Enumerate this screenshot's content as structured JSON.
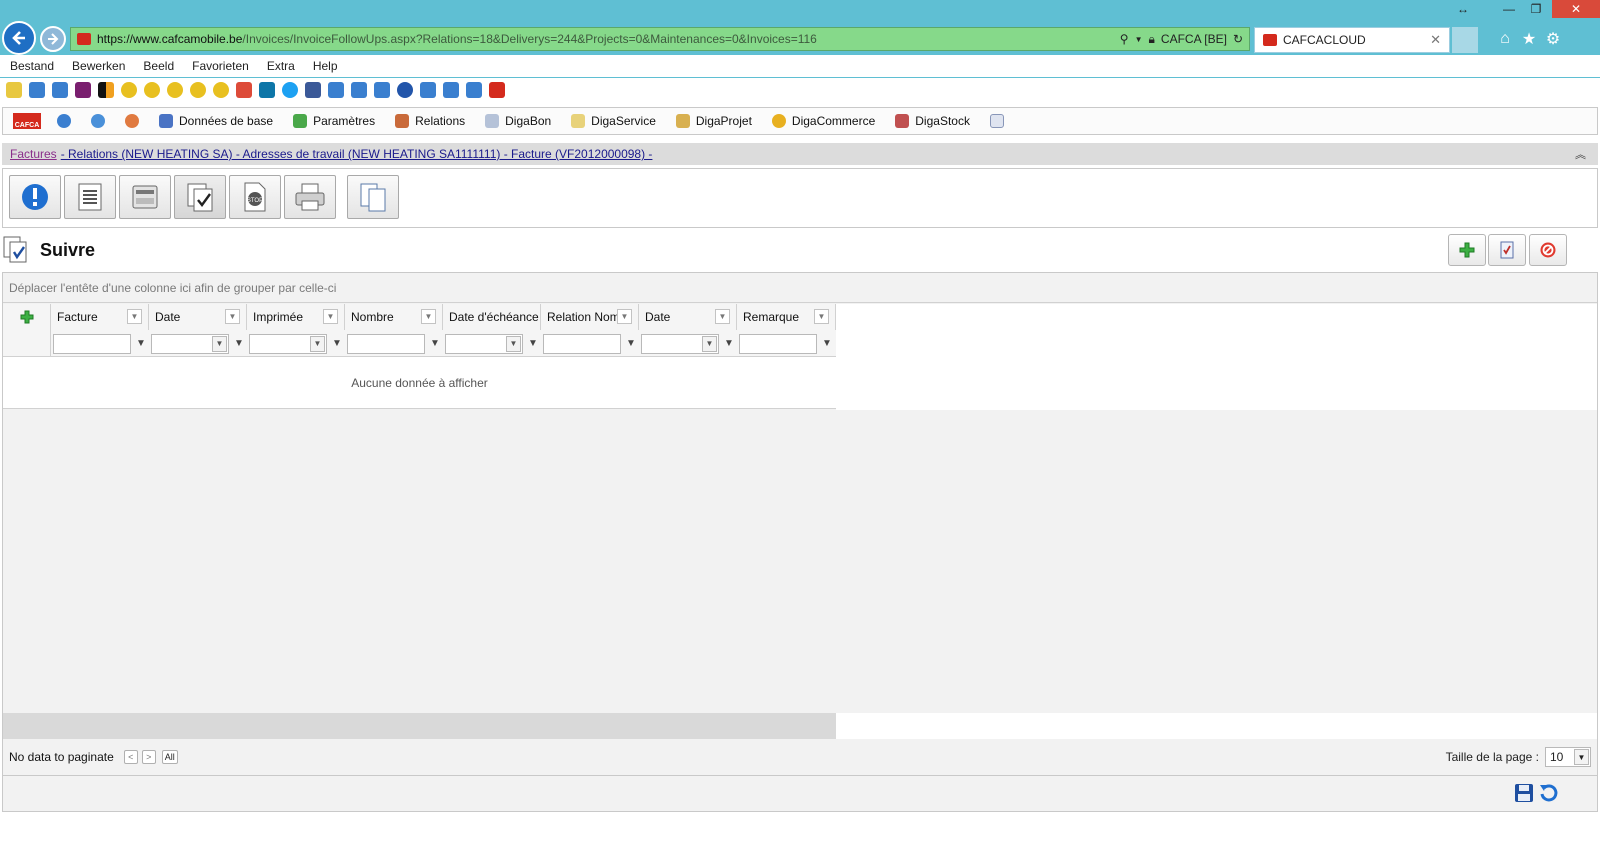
{
  "browser": {
    "url_host": "https://www.cafcamobile.be",
    "url_rest": "/Invoices/InvoiceFollowUps.aspx?Relations=18&Deliverys=244&Projects=0&Maintenances=0&Invoices=116",
    "cert_label": "CAFCA [BE]",
    "tab_title": "CAFCACLOUD"
  },
  "menu": [
    "Bestand",
    "Bewerken",
    "Beeld",
    "Favorieten",
    "Extra",
    "Help"
  ],
  "app_nav": {
    "logo": "CAFCA",
    "items": [
      "Données de base",
      "Paramètres",
      "Relations",
      "DigaBon",
      "DigaService",
      "DigaProjet",
      "DigaCommerce",
      "DigaStock"
    ]
  },
  "breadcrumb": {
    "first": "Factures",
    "rest": "- Relations (NEW HEATING SA) - Adresses de travail (NEW HEATING SA1111111) - Facture (VF2012000098) -"
  },
  "section_title": "Suivre",
  "grid": {
    "group_hint": "Déplacer l'entête d'une colonne ici afin de grouper par celle-ci",
    "columns": [
      "Facture",
      "Date",
      "Imprimée",
      "Nombre",
      "Date d'échéance",
      "Relation Nom",
      "Date",
      "Remarque"
    ],
    "empty_text": "Aucune donnée à afficher"
  },
  "pager": {
    "text": "No data to paginate",
    "all_label": "All",
    "page_size_label": "Taille de la page :",
    "page_size": "10"
  }
}
